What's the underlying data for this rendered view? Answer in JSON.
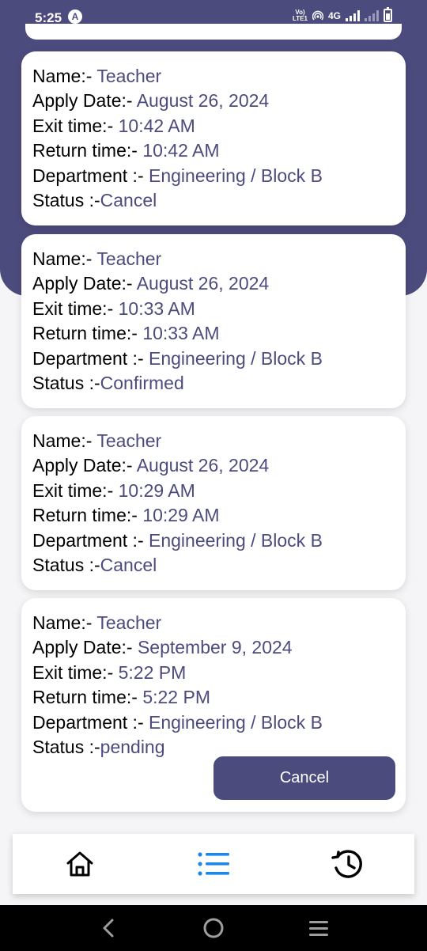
{
  "status_bar": {
    "time": "5:25",
    "app_icon": "A",
    "volte": "Vo)\nLTE1",
    "network": "4G"
  },
  "labels": {
    "name": "Name:- ",
    "apply_date": "Apply Date:- ",
    "exit_time": "Exit time:- ",
    "return_time": "Return time:- ",
    "department": "Department :- ",
    "status": "Status :-"
  },
  "requests": [
    {
      "name": "Teacher",
      "apply_date": "August 26, 2024",
      "exit_time": "10:42 AM",
      "return_time": "10:42 AM",
      "department": "Engineering / Block B",
      "status": "Cancel"
    },
    {
      "name": "Teacher",
      "apply_date": "August 26, 2024",
      "exit_time": "10:33 AM",
      "return_time": "10:33 AM",
      "department": "Engineering / Block B",
      "status": "Confirmed"
    },
    {
      "name": "Teacher",
      "apply_date": "August 26, 2024",
      "exit_time": "10:29 AM",
      "return_time": "10:29 AM",
      "department": "Engineering / Block B",
      "status": "Cancel"
    },
    {
      "name": "Teacher",
      "apply_date": "September 9, 2024",
      "exit_time": "5:22 PM",
      "return_time": "5:22 PM",
      "department": "Engineering / Block B",
      "status": "pending",
      "action_label": "Cancel"
    }
  ],
  "bottom_nav": {
    "items": [
      {
        "icon": "home-icon",
        "active": false
      },
      {
        "icon": "list-icon",
        "active": true
      },
      {
        "icon": "history-icon",
        "active": false
      }
    ]
  },
  "colors": {
    "primary": "#4c4b7d",
    "active_nav": "#1e88e5",
    "background": "#f5f5f7"
  }
}
